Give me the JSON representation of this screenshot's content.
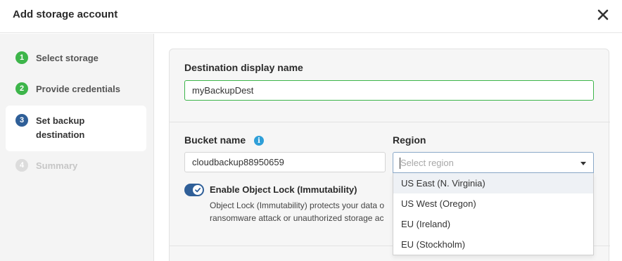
{
  "dialog": {
    "title": "Add storage account"
  },
  "steps": [
    {
      "number": "1",
      "label": "Select storage",
      "state": "done"
    },
    {
      "number": "2",
      "label": "Provide credentials",
      "state": "done"
    },
    {
      "number": "3",
      "label": "Set backup destination",
      "label_line1": "Set backup",
      "label_line2": "destination",
      "state": "active"
    },
    {
      "number": "4",
      "label": "Summary",
      "state": "disabled"
    }
  ],
  "destination": {
    "label": "Destination display name",
    "value": "myBackupDest"
  },
  "bucket": {
    "label": "Bucket name",
    "value": "cloudbackup88950659"
  },
  "region": {
    "label": "Region",
    "placeholder": "Select region",
    "options": [
      "US East (N. Virginia)",
      "US West (Oregon)",
      "EU (Ireland)",
      "EU (Stockholm)"
    ]
  },
  "object_lock": {
    "label": "Enable Object Lock (Immutability)",
    "enabled": true,
    "description_line1": "Object Lock (Immutability) protects your data o",
    "description_line2": "ransomware attack or unauthorized storage ac"
  },
  "colors": {
    "success": "#3db54a",
    "primary": "#2f5f98",
    "info": "#2f9fd8"
  }
}
